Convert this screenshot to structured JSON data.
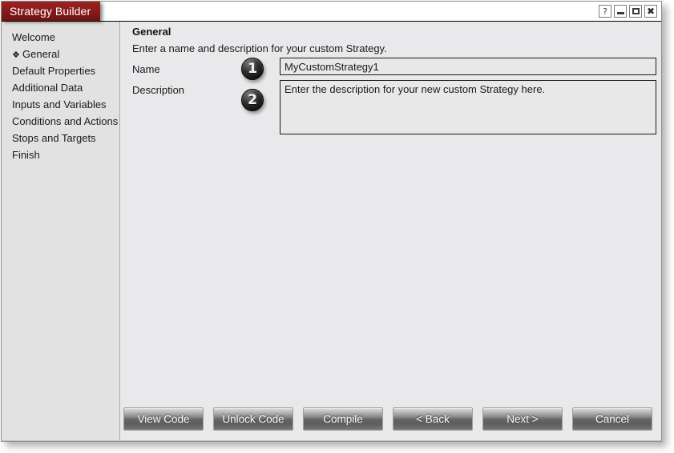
{
  "window": {
    "title": "Strategy Builder",
    "controls": [
      {
        "name": "help-button",
        "glyph": "?"
      },
      {
        "name": "minimize-button",
        "glyph": "–"
      },
      {
        "name": "maximize-button",
        "glyph": "❐"
      },
      {
        "name": "close-button",
        "glyph": "✖"
      }
    ]
  },
  "sidebar": {
    "items": [
      {
        "label": "Welcome",
        "current": false,
        "marker": ""
      },
      {
        "label": "General",
        "current": true,
        "marker": "❖"
      },
      {
        "label": "Default Properties",
        "current": false,
        "marker": ""
      },
      {
        "label": "Additional Data",
        "current": false,
        "marker": ""
      },
      {
        "label": "Inputs and Variables",
        "current": false,
        "marker": ""
      },
      {
        "label": "Conditions and Actions",
        "current": false,
        "marker": ""
      },
      {
        "label": "Stops and Targets",
        "current": false,
        "marker": ""
      },
      {
        "label": "Finish",
        "current": false,
        "marker": ""
      }
    ]
  },
  "main": {
    "title": "General",
    "subtitle": "Enter a name and description for your custom Strategy.",
    "fields": {
      "name_label": "Name",
      "name_value": "MyCustomStrategy1",
      "description_label": "Description",
      "description_value": "Enter the description for your new custom Strategy here."
    },
    "callouts": [
      {
        "number": "1"
      },
      {
        "number": "2"
      }
    ]
  },
  "buttons": [
    {
      "label": "View Code",
      "name": "view-code-button"
    },
    {
      "label": "Unlock Code",
      "name": "unlock-code-button"
    },
    {
      "label": "Compile",
      "name": "compile-button"
    },
    {
      "label": "< Back",
      "name": "back-button"
    },
    {
      "label": "Next >",
      "name": "next-button"
    },
    {
      "label": "Cancel",
      "name": "cancel-button"
    }
  ],
  "colors": {
    "title_accent": "#8a1b1b",
    "sidebar_bg": "#e2e2e2",
    "content_bg": "#e9e9eb",
    "field_bg": "#e8e8e8"
  }
}
